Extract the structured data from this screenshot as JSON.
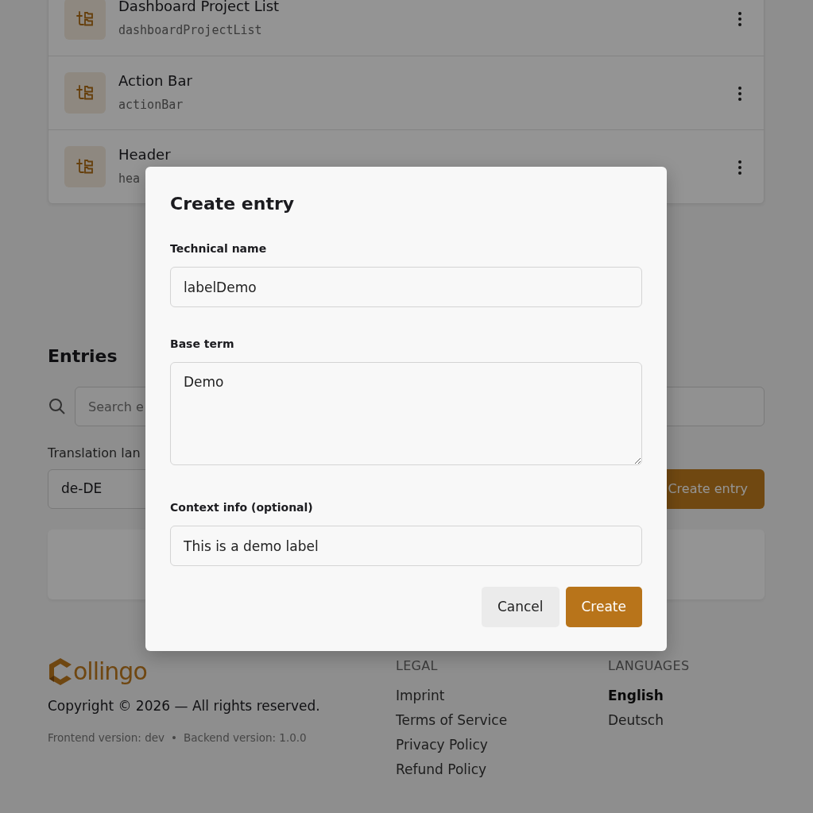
{
  "list_items": [
    {
      "title": "Dashboard Project List",
      "key": "dashboardProjectList"
    },
    {
      "title": "Action Bar",
      "key": "actionBar"
    },
    {
      "title": "Header",
      "key": "hea"
    }
  ],
  "entries": {
    "heading": "Entries",
    "search": {
      "placeholder": "Search e"
    },
    "language_label": "Translation lan",
    "language_value": "de-DE",
    "create_button": "Create entry"
  },
  "modal": {
    "title": "Create entry",
    "fields": [
      {
        "kind": "input",
        "label": "Technical name",
        "value": "labelDemo"
      },
      {
        "kind": "textarea",
        "label": "Base term",
        "value": "Demo"
      },
      {
        "kind": "input",
        "label": "Context info (optional)",
        "value": "This is a demo label"
      }
    ],
    "buttons": [
      {
        "label": "Cancel",
        "kind": "secondary"
      },
      {
        "label": "Create",
        "kind": "primary"
      }
    ]
  },
  "footer": {
    "logo": "ollingo",
    "copyright": "Copyright © 2026 — All rights reserved.",
    "versions": [
      "Frontend version: dev",
      "Backend version: 1.0.0"
    ],
    "separator": "•",
    "legal": {
      "heading": "LEGAL",
      "links": [
        "Imprint",
        "Terms of Service",
        "Privacy Policy",
        "Refund Policy"
      ]
    },
    "languages": {
      "heading": "LANGUAGES",
      "items": [
        {
          "label": "English",
          "selected": true
        },
        {
          "label": "Deutsch",
          "selected": false
        }
      ]
    }
  }
}
